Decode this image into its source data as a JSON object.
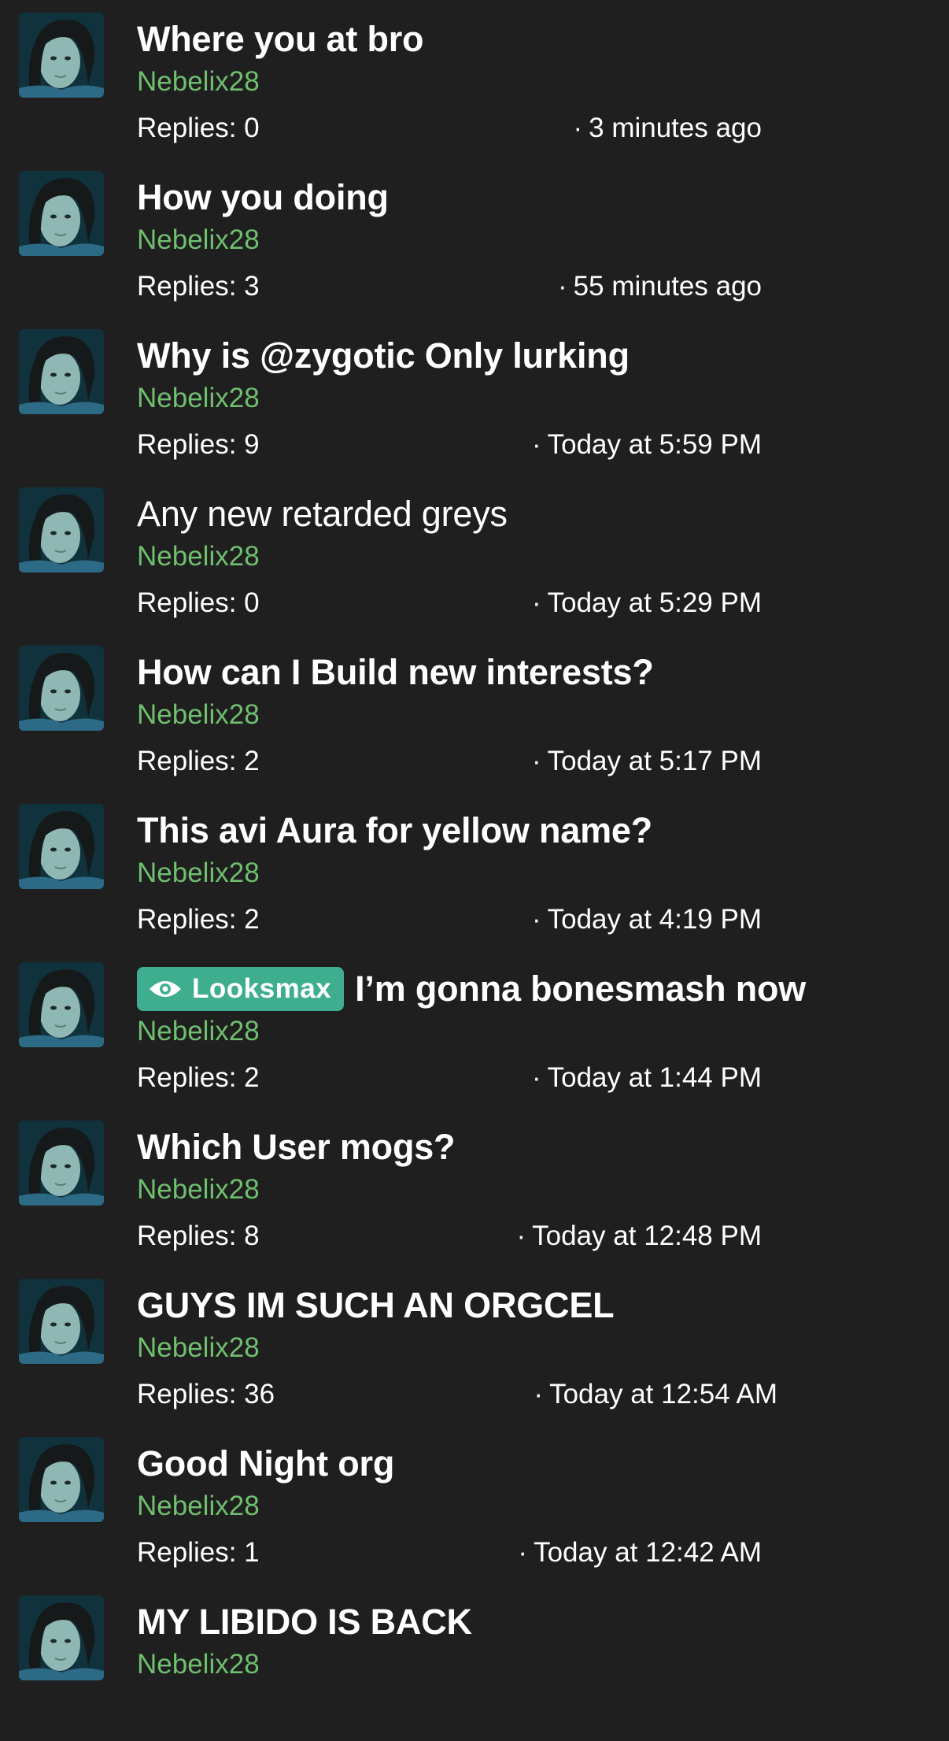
{
  "threads": [
    {
      "title": "Where you at bro",
      "author": "Nebelix28",
      "replies": "Replies: 0",
      "time": "3 minutes ago"
    },
    {
      "title": "How you doing",
      "author": "Nebelix28",
      "replies": "Replies: 3",
      "time": "55 minutes ago"
    },
    {
      "title": "Why is @zygotic Only lurking",
      "author": "Nebelix28",
      "replies": "Replies: 9",
      "time": "Today at 5:59 PM"
    },
    {
      "title": "Any new retarded greys",
      "author": "Nebelix28",
      "replies": "Replies: 0",
      "time": "Today at 5:29 PM",
      "unread": false
    },
    {
      "title": "How can I Build new interests?",
      "author": "Nebelix28",
      "replies": "Replies: 2",
      "time": "Today at 5:17 PM"
    },
    {
      "title": "This avi Aura for yellow name?",
      "author": "Nebelix28",
      "replies": "Replies: 2",
      "time": "Today at 4:19 PM"
    },
    {
      "title": "I’m gonna bonesmash now",
      "prefix": "Looksmax",
      "author": "Nebelix28",
      "replies": "Replies: 2",
      "time": "Today at 1:44 PM"
    },
    {
      "title": "Which User mogs?",
      "author": "Nebelix28",
      "replies": "Replies: 8",
      "time": "Today at 12:48 PM"
    },
    {
      "title": "GUYS IM SUCH AN ORGCEL",
      "author": "Nebelix28",
      "replies": "Replies: 36",
      "time": "Today at 12:54 AM"
    },
    {
      "title": "Good Night org",
      "author": "Nebelix28",
      "replies": "Replies: 1",
      "time": "Today at 12:42 AM"
    },
    {
      "title": "MY LIBIDO IS BACK",
      "author": "Nebelix28"
    }
  ],
  "separator": "·",
  "colors": {
    "background": "#1f1f1f",
    "author": "#6fbf6f",
    "prefix_badge": "#3fae8f",
    "text": "#ffffff"
  },
  "icons": {
    "prefix": "eye-icon",
    "avatar": "user-avatar-photo"
  }
}
